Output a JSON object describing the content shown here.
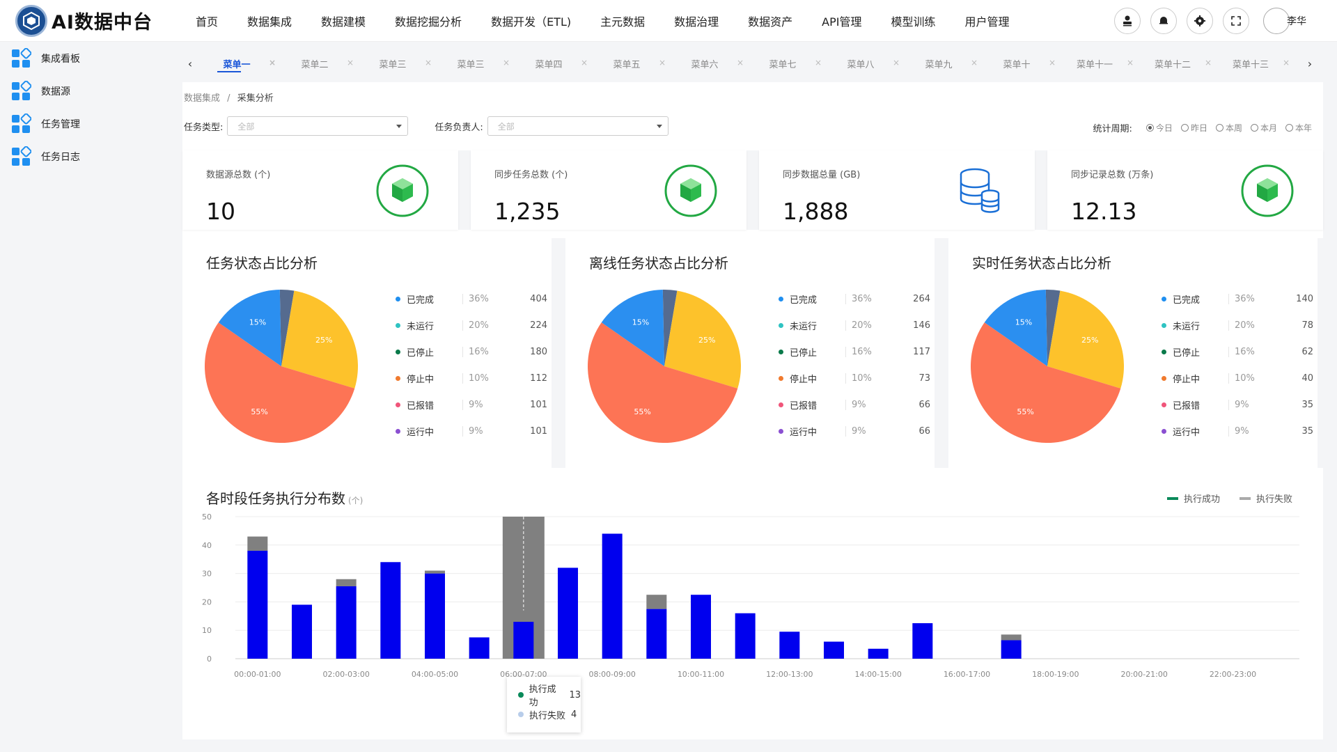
{
  "app": {
    "title": "AI数据中台"
  },
  "topnav": [
    "首页",
    "数据集成",
    "数据建模",
    "数据挖掘分析",
    "数据开发（ETL)",
    "主元数据",
    "数据治理",
    "数据资产",
    "API管理",
    "模型训练",
    "用户管理"
  ],
  "user": {
    "name": "李华"
  },
  "sidebar": [
    {
      "label": "集成看板"
    },
    {
      "label": "数据源"
    },
    {
      "label": "任务管理"
    },
    {
      "label": "任务日志"
    }
  ],
  "tabs": [
    "菜单一",
    "菜单二",
    "菜单三",
    "菜单三",
    "菜单四",
    "菜单五",
    "菜单六",
    "菜单七",
    "菜单八",
    "菜单九",
    "菜单十",
    "菜单十一",
    "菜单十二",
    "菜单十三"
  ],
  "breadcrumb": {
    "parent": "数据集成",
    "separator": "/",
    "current": "采集分析"
  },
  "filters": {
    "task_type_label": "任务类型:",
    "task_type_value": "全部",
    "owner_label": "任务负责人:",
    "owner_value": "全部",
    "period_label": "统计周期:",
    "periods": [
      "今日",
      "昨日",
      "本周",
      "本月",
      "本年"
    ],
    "period_selected": "今日"
  },
  "stats": [
    {
      "label": "数据源总数 (个)",
      "value": "10",
      "icon": "cube-icon"
    },
    {
      "label": "同步任务总数 (个)",
      "value": "1,235",
      "icon": "cube-icon"
    },
    {
      "label": "同步数据总量 (GB)",
      "value": "1,888",
      "icon": "database-icon"
    },
    {
      "label": "同步记录总数 (万条)",
      "value": "12.13",
      "icon": "cube-icon"
    }
  ],
  "colors": {
    "completed": "#1f8ff0",
    "not_running": "#2fc3c2",
    "stopped": "#0a7a4a",
    "stopping": "#f07a2e",
    "error": "#f0557a",
    "running": "#8a4fd1",
    "pie_blue": "#2b8ff0",
    "pie_yellow": "#fdc22b",
    "pie_red": "#fd7455",
    "pie_slate": "#556b8f",
    "bar_success": "#0000ee",
    "bar_fail": "#808080"
  },
  "pies": [
    {
      "title": "任务状态占比分析",
      "legend": [
        {
          "name": "已完成",
          "pct": "36%",
          "value": "404"
        },
        {
          "name": "未运行",
          "pct": "20%",
          "value": "224"
        },
        {
          "name": "已停止",
          "pct": "16%",
          "value": "180"
        },
        {
          "name": "停止中",
          "pct": "10%",
          "value": "112"
        },
        {
          "name": "已报错",
          "pct": "9%",
          "value": "101"
        },
        {
          "name": "运行中",
          "pct": "9%",
          "value": "101"
        }
      ]
    },
    {
      "title": "离线任务状态占比分析",
      "legend": [
        {
          "name": "已完成",
          "pct": "36%",
          "value": "264"
        },
        {
          "name": "未运行",
          "pct": "20%",
          "value": "146"
        },
        {
          "name": "已停止",
          "pct": "16%",
          "value": "117"
        },
        {
          "name": "停止中",
          "pct": "10%",
          "value": "73"
        },
        {
          "name": "已报错",
          "pct": "9%",
          "value": "66"
        },
        {
          "name": "运行中",
          "pct": "9%",
          "value": "66"
        }
      ]
    },
    {
      "title": "实时任务状态占比分析",
      "legend": [
        {
          "name": "已完成",
          "pct": "36%",
          "value": "140"
        },
        {
          "name": "未运行",
          "pct": "20%",
          "value": "78"
        },
        {
          "name": "已停止",
          "pct": "16%",
          "value": "62"
        },
        {
          "name": "停止中",
          "pct": "10%",
          "value": "40"
        },
        {
          "name": "已报错",
          "pct": "9%",
          "value": "35"
        },
        {
          "name": "运行中",
          "pct": "9%",
          "value": "35"
        }
      ]
    }
  ],
  "chart_data": [
    {
      "type": "pie",
      "slices": [
        {
          "label": "55%",
          "value": 55,
          "color": "#fd7455"
        },
        {
          "label": "15%",
          "value": 15,
          "color": "#2b8ff0"
        },
        {
          "label": "",
          "value": 3,
          "color": "#556b8f"
        },
        {
          "label": "25%",
          "value": 27,
          "color": "#fdc22b"
        }
      ]
    },
    {
      "type": "pie",
      "slices": [
        {
          "label": "55%",
          "value": 55,
          "color": "#fd7455"
        },
        {
          "label": "15%",
          "value": 15,
          "color": "#2b8ff0"
        },
        {
          "label": "",
          "value": 3,
          "color": "#556b8f"
        },
        {
          "label": "25%",
          "value": 27,
          "color": "#fdc22b"
        }
      ]
    },
    {
      "type": "pie",
      "slices": [
        {
          "label": "55%",
          "value": 55,
          "color": "#fd7455"
        },
        {
          "label": "15%",
          "value": 15,
          "color": "#2b8ff0"
        },
        {
          "label": "",
          "value": 3,
          "color": "#556b8f"
        },
        {
          "label": "25%",
          "value": 27,
          "color": "#fdc22b"
        }
      ]
    },
    {
      "type": "bar",
      "title": "各时段任务执行分布数",
      "unit": "(个)",
      "stacked": true,
      "categories": [
        "00:00-01:00",
        "01:00-02:00",
        "02:00-03:00",
        "03:00-04:00",
        "04:00-05:00",
        "05:00-06:00",
        "06:00-07:00",
        "07:00-08:00",
        "08:00-09:00",
        "09:00-10:00",
        "10:00-11:00",
        "11:00-12:00",
        "12:00-13:00",
        "13:00-14:00",
        "14:00-15:00",
        "15:00-16:00",
        "16:00-17:00",
        "17:00-18:00",
        "18:00-19:00",
        "19:00-20:00",
        "20:00-21:00",
        "21:00-22:00",
        "22:00-23:00",
        "23:00-24:00"
      ],
      "x_tick_labels": [
        "00:00-01:00",
        "02:00-03:00",
        "04:00-05:00",
        "06:00-07:00",
        "08:00-09:00",
        "10:00-11:00",
        "12:00-13:00",
        "14:00-15:00",
        "16:00-17:00",
        "18:00-19:00",
        "20:00-21:00",
        "22:00-23:00"
      ],
      "ylim": [
        0,
        50
      ],
      "yticks": [
        0,
        10,
        20,
        30,
        40,
        50
      ],
      "grid": true,
      "legend_position": "top-right",
      "series": [
        {
          "name": "执行成功",
          "values": [
            38,
            19,
            25.5,
            34,
            30,
            7.5,
            13,
            32,
            44,
            17.5,
            22.5,
            16,
            9.5,
            6,
            3.5,
            12.5,
            0,
            6.5,
            0,
            0,
            0,
            0,
            0,
            0
          ]
        },
        {
          "name": "执行失败",
          "values": [
            5,
            0,
            2.5,
            0,
            1,
            0,
            4,
            0,
            0,
            5,
            0,
            0,
            0,
            0,
            0,
            0,
            0,
            2,
            0,
            0,
            0,
            0,
            0,
            0
          ]
        }
      ],
      "legend_colors": [
        "#0a8a5a",
        "#aaaaaa"
      ],
      "highlight_category": "06:00-07:00",
      "tooltip": {
        "rows": [
          {
            "name": "执行成功",
            "value": "13"
          },
          {
            "name": "执行失败",
            "value": "4"
          }
        ]
      }
    }
  ]
}
